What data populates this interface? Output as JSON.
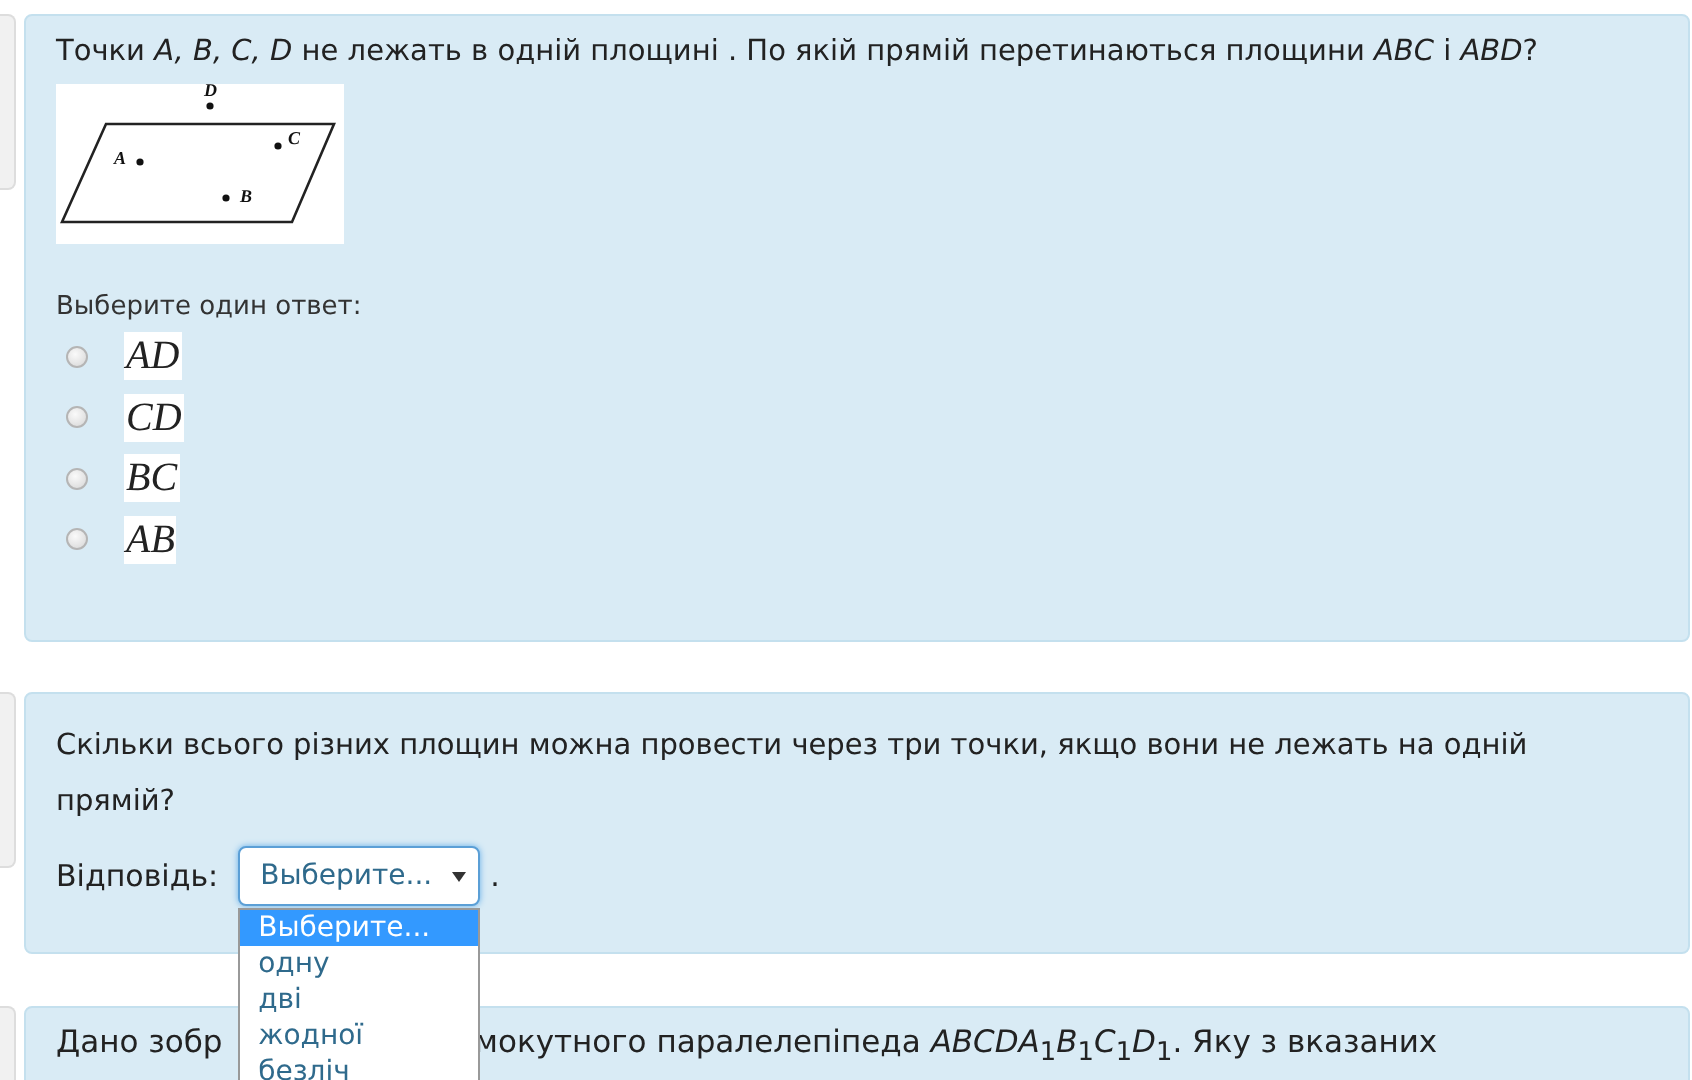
{
  "questions": [
    {
      "kind": "multichoice",
      "text": "Точки *A, B, C, D* не лежать в одній площині . По якій прямій перетинаються площини *ABC* і *ABD*?",
      "figure_labels": [
        "D",
        "A",
        "C",
        "B"
      ],
      "prompt": "Выберите один ответ:",
      "options": [
        {
          "label": "AD",
          "selected": false
        },
        {
          "label": "CD",
          "selected": false
        },
        {
          "label": "BC",
          "selected": false
        },
        {
          "label": "AB",
          "selected": false
        }
      ]
    },
    {
      "kind": "select",
      "text": "Скільки всього різних площин можна провести через три точки, якщо вони не лежать на одній прямій?",
      "answer_label": "Відповідь:",
      "select": {
        "value": "Выберите...",
        "suffix": ".",
        "expanded": true,
        "options": [
          {
            "label": "Выберите...",
            "selected": true
          },
          {
            "label": "одну",
            "selected": false
          },
          {
            "label": "дві",
            "selected": false
          },
          {
            "label": "жодної",
            "selected": false
          },
          {
            "label": "безліч",
            "selected": false
          }
        ]
      }
    },
    {
      "kind": "partial",
      "text_left": "Дано зобр",
      "text_right": "мокутного паралелепіпеда *ABCDA*$_{1}$*B*$_{1}$*C*$_{1}$*D*$_{1}$. Яку з вказаних"
    }
  ]
}
